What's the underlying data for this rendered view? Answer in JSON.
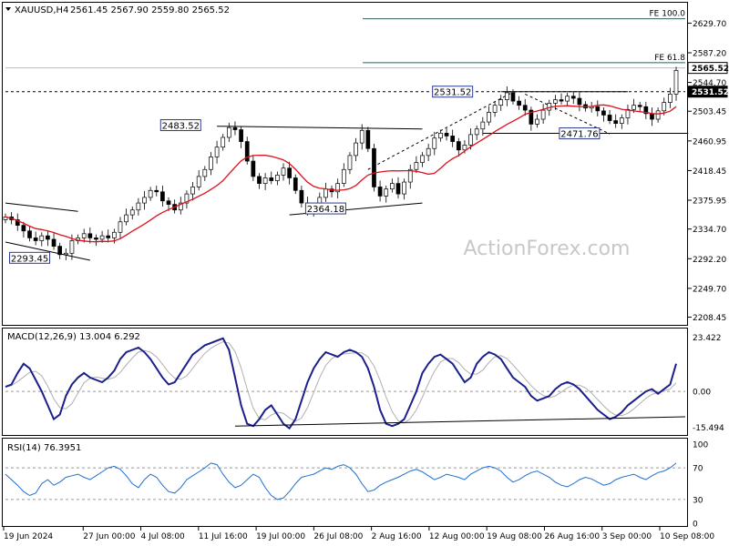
{
  "chart_data": [
    {
      "type": "candlestick",
      "panel": "price",
      "symbol_label": "XAUUSD,H4",
      "ohlc_label": "2561.45 2567.90 2559.80 2565.52",
      "watermark": "ActionForex.com",
      "ylim": [
        2200,
        2655
      ],
      "y_ticks": [
        "2629.70",
        "2587.20",
        "2544.70",
        "2503.45",
        "2460.95",
        "2418.45",
        "2375.95",
        "2334.70",
        "2292.20",
        "2249.70",
        "2208.45"
      ],
      "x_ticks": [
        "19 Jun 2024",
        "27 Jun 00:00",
        "4 Jul 08:00",
        "11 Jul 16:00",
        "19 Jul 00:00",
        "26 Jul 08:00",
        "2 Aug 16:00",
        "12 Aug 00:00",
        "19 Aug 08:00",
        "26 Aug 16:00",
        "3 Sep 00:00",
        "10 Sep 08:00"
      ],
      "last_price_label": "2565.52",
      "level_label": "2531.52",
      "fib_levels": [
        {
          "label": "FE 100.0",
          "value": 2636
        },
        {
          "label": "FE 61.8",
          "value": 2573
        }
      ],
      "annotations": [
        {
          "label": "2483.52",
          "value": 2483.52
        },
        {
          "label": "2531.52",
          "value": 2531.52
        },
        {
          "label": "2471.76",
          "value": 2471.76
        },
        {
          "label": "2364.18",
          "value": 2364.18
        },
        {
          "label": "2293.45",
          "value": 2293.45
        }
      ],
      "close_path": [
        2352,
        2348,
        2340,
        2332,
        2322,
        2318,
        2325,
        2320,
        2310,
        2298,
        2300,
        2318,
        2322,
        2328,
        2322,
        2320,
        2325,
        2322,
        2330,
        2345,
        2355,
        2362,
        2372,
        2380,
        2390,
        2388,
        2375,
        2370,
        2362,
        2372,
        2385,
        2395,
        2410,
        2420,
        2438,
        2452,
        2466,
        2480,
        2477,
        2460,
        2432,
        2410,
        2400,
        2408,
        2404,
        2412,
        2422,
        2408,
        2390,
        2372,
        2362,
        2366,
        2380,
        2392,
        2388,
        2400,
        2420,
        2440,
        2458,
        2476,
        2450,
        2395,
        2382,
        2392,
        2400,
        2385,
        2402,
        2420,
        2430,
        2440,
        2450,
        2465,
        2472,
        2468,
        2460,
        2448,
        2455,
        2470,
        2478,
        2488,
        2502,
        2512,
        2520,
        2530,
        2518,
        2512,
        2505,
        2485,
        2492,
        2505,
        2515,
        2520,
        2518,
        2525,
        2522,
        2513,
        2508,
        2510,
        2504,
        2498,
        2490,
        2486,
        2494,
        2506,
        2512,
        2510,
        2500,
        2492,
        2504,
        2516,
        2528,
        2562
      ]
    },
    {
      "type": "line",
      "panel": "macd",
      "label": "MACD(12,26,9) 13.004 6.292",
      "ylim": [
        -16.5,
        24.5
      ],
      "y_ticks": [
        "23.422",
        "0.00",
        "-15.494"
      ],
      "macd": [
        2,
        3,
        8,
        12,
        10,
        5,
        0,
        -6,
        -12,
        -10,
        -2,
        3,
        6,
        8,
        6,
        5,
        4,
        6,
        9,
        14,
        17,
        18,
        19,
        17,
        14,
        10,
        6,
        3,
        4,
        8,
        12,
        16,
        18,
        20,
        21,
        22,
        23,
        18,
        6,
        -6,
        -14,
        -15,
        -12,
        -8,
        -6,
        -10,
        -14,
        -16,
        -12,
        -4,
        4,
        10,
        14,
        17,
        16,
        15,
        17,
        18,
        17,
        15,
        10,
        2,
        -8,
        -14,
        -15,
        -14,
        -12,
        -6,
        0,
        8,
        12,
        15,
        16,
        14,
        12,
        8,
        4,
        6,
        12,
        15,
        17,
        16,
        14,
        10,
        6,
        4,
        2,
        -2,
        -4,
        -3,
        -2,
        1,
        3,
        4,
        3,
        1,
        -2,
        -5,
        -8,
        -10,
        -12,
        -11,
        -9,
        -6,
        -4,
        -2,
        0,
        1,
        -1,
        1,
        3,
        12
      ]
    },
    {
      "type": "line",
      "panel": "rsi",
      "label": "RSI(14) 76.3951",
      "ylim": [
        0,
        100
      ],
      "y_ticks": [
        "100",
        "70",
        "30",
        "0"
      ],
      "rsi": [
        62,
        55,
        48,
        40,
        35,
        38,
        50,
        55,
        48,
        52,
        58,
        60,
        62,
        58,
        55,
        60,
        65,
        70,
        72,
        68,
        60,
        50,
        45,
        55,
        62,
        58,
        48,
        40,
        38,
        45,
        55,
        60,
        65,
        70,
        76,
        74,
        62,
        52,
        45,
        48,
        55,
        62,
        58,
        45,
        35,
        30,
        32,
        40,
        50,
        58,
        60,
        62,
        66,
        70,
        68,
        72,
        74,
        70,
        62,
        50,
        40,
        42,
        48,
        52,
        55,
        58,
        62,
        66,
        68,
        65,
        60,
        55,
        58,
        62,
        60,
        58,
        55,
        62,
        66,
        70,
        72,
        70,
        66,
        58,
        52,
        55,
        60,
        64,
        66,
        62,
        58,
        52,
        48,
        46,
        50,
        55,
        58,
        56,
        52,
        48,
        50,
        55,
        58,
        60,
        62,
        58,
        55,
        60,
        64,
        66,
        70,
        76
      ]
    }
  ]
}
